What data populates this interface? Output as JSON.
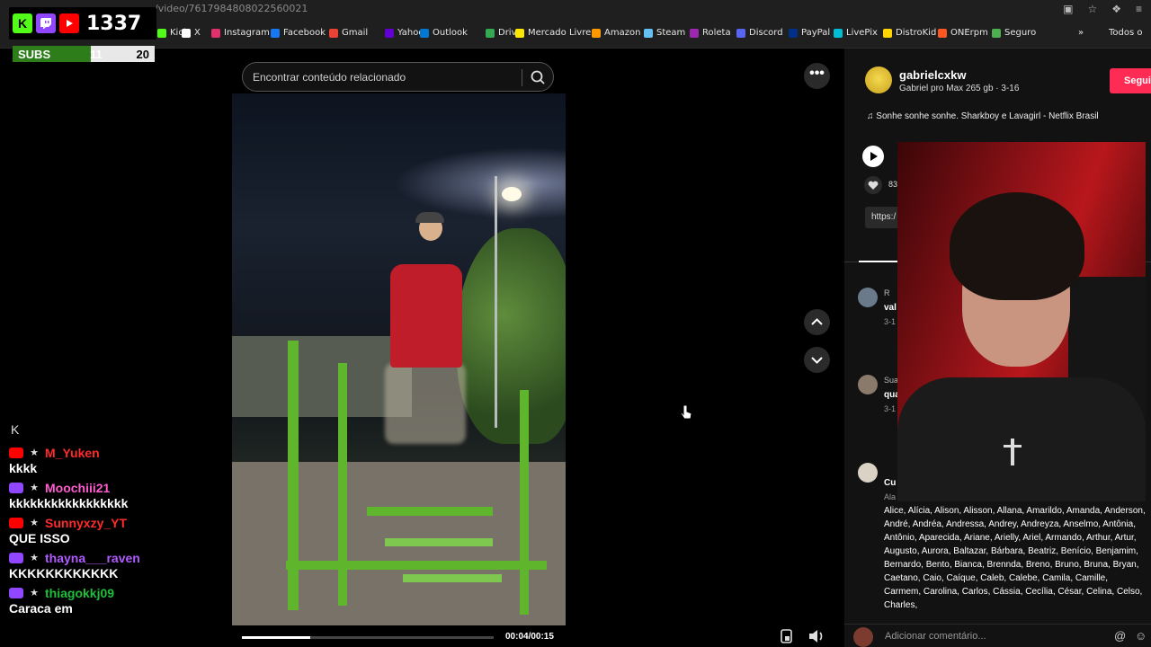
{
  "browser": {
    "url": "/video/7617984808022560021",
    "bookmarks": [
      {
        "label": "Kick",
        "color": "#53fc18"
      },
      {
        "label": "X",
        "color": "#ffffff"
      },
      {
        "label": "Instagram",
        "color": "#e1306c"
      },
      {
        "label": "Facebook",
        "color": "#1877f2"
      },
      {
        "label": "Gmail",
        "color": "#ea4335"
      },
      {
        "label": "Yahoo!",
        "color": "#6001d2"
      },
      {
        "label": "Outlook",
        "color": "#0078d4"
      },
      {
        "label": "Drive",
        "color": "#34a853"
      },
      {
        "label": "Mercado Livre",
        "color": "#ffe600"
      },
      {
        "label": "Amazon",
        "color": "#ff9900"
      },
      {
        "label": "Steam",
        "color": "#66c0f4"
      },
      {
        "label": "Roleta",
        "color": "#9c27b0"
      },
      {
        "label": "Discord",
        "color": "#5865f2"
      },
      {
        "label": "PayPal",
        "color": "#003087"
      },
      {
        "label": "LivePix",
        "color": "#00bcd4"
      },
      {
        "label": "DistroKid",
        "color": "#ffd400"
      },
      {
        "label": "ONErpm",
        "color": "#ff5722"
      },
      {
        "label": "Seguro",
        "color": "#4caf50"
      }
    ],
    "more_bookmarks": "»",
    "all_bookmarks": "Todos o"
  },
  "overlay": {
    "viewer_count": "1337",
    "subs_label": "SUBS",
    "subs_current": "11",
    "subs_goal": "20",
    "subs_progress": 0.55
  },
  "chat": {
    "header": "K",
    "messages": [
      {
        "platform": "youtube",
        "user": "M_Yuken",
        "user_color": "#ff2b2b",
        "text": "kkkk"
      },
      {
        "platform": "twitch",
        "user": "Moochiii21",
        "user_color": "#ff5bd0",
        "text": "kkkkkkkkkkkkkkkkk"
      },
      {
        "platform": "youtube",
        "user": "Sunnyxzy_YT",
        "user_color": "#ff2b2b",
        "text": "QUE ISSO"
      },
      {
        "platform": "twitch",
        "user": "thayna___raven",
        "user_color": "#b15bff",
        "text": "KKKKKKKKKKKK"
      },
      {
        "platform": "twitch",
        "user": "thiagokkj09",
        "user_color": "#1fbf3a",
        "text": "Caraca em"
      }
    ]
  },
  "search": {
    "placeholder": "Encontrar conteúdo relacionado"
  },
  "video": {
    "time": "00:04/00:15",
    "progress": 0.27
  },
  "post": {
    "username": "gabrielcxkw",
    "subtitle": "Gabriel pro Max 265 gb · 3-16",
    "follow_label": "Segui",
    "music": "♫  Sonhe sonhe sonhe. Sharkboy e Lavagirl - Netflix Brasil",
    "likes": "83",
    "link_text": "https:/"
  },
  "comments": [
    {
      "name": "R",
      "text": "val",
      "date": "3-1"
    },
    {
      "name": "Sua",
      "text": "qua",
      "date": "3-1"
    },
    {
      "name": "",
      "text": "Cu",
      "date": "Ala"
    }
  ],
  "names_list": "Alice, Alícia, Alison, Alisson, Allana, Amarildo, Amanda, Anderson, André, Andréa, Andressa, Andrey, Andreyza, Anselmo, Antônia, Antônio, Aparecida, Ariane, Arielly, Ariel, Armando, Arthur, Artur, Augusto, Aurora, Baltazar, Bárbara, Beatriz, Benício, Benjamim, Bernardo, Bento, Bianca, Brennda, Breno, Bruno, Bruna, Bryan, Caetano, Caio, Caíque, Caleb, Calebe, Camila, Camille, Carmem, Carolina, Carlos, Cássia, Cecília, César, Celina, Celso, Charles,",
  "comment_input": {
    "placeholder": "Adicionar comentário..."
  },
  "colors": {
    "kick": "#53fc18",
    "twitch": "#9146ff",
    "youtube": "#ff0000",
    "follow": "#fe2c55",
    "subs_fill": "#2e7d1b"
  }
}
